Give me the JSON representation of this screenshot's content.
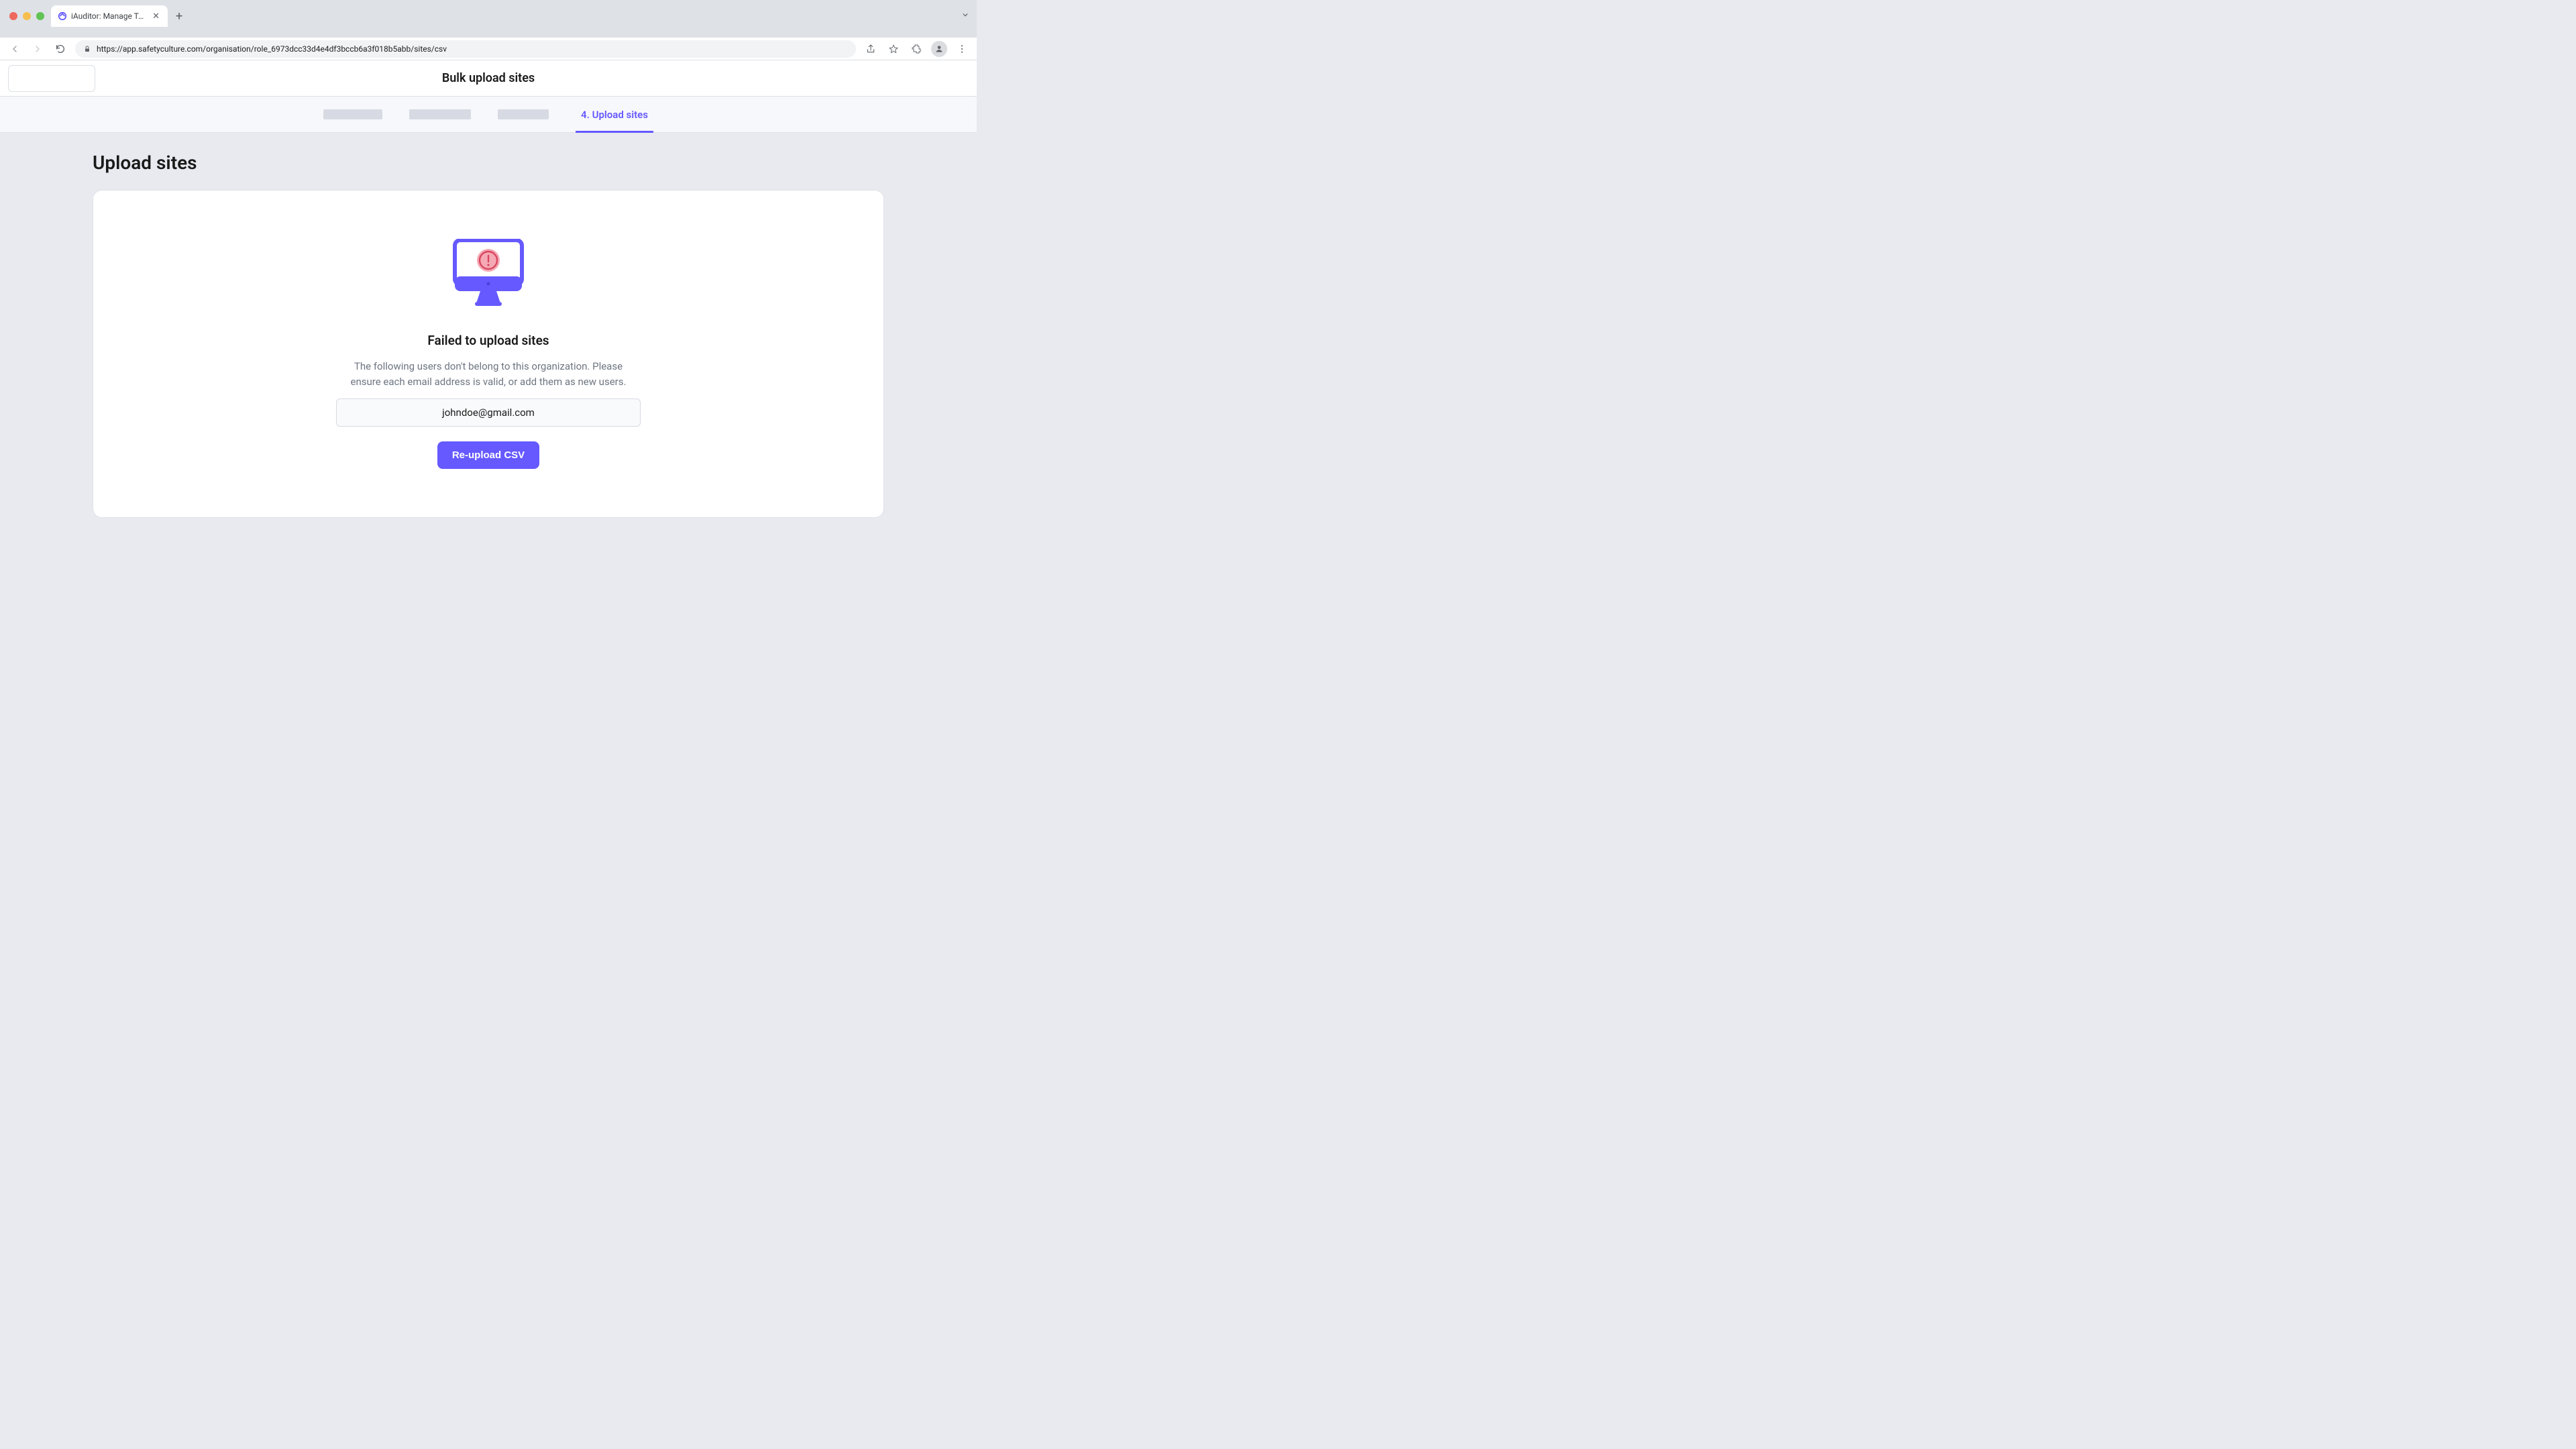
{
  "browser": {
    "tab_title": "iAuditor: Manage Teams and In",
    "url": "https://app.safetyculture.com/organisation/role_6973dcc33d4e4df3bccb6a3f018b5abb/sites/csv"
  },
  "header": {
    "title": "Bulk upload sites"
  },
  "stepper": {
    "active_label": "4. Upload sites"
  },
  "page": {
    "heading": "Upload sites"
  },
  "error_card": {
    "title": "Failed to upload sites",
    "description": "The following users don't belong to this organization. Please ensure each email address is valid, or add them as new users.",
    "email": "johndoe@gmail.com",
    "button_label": "Re-upload CSV"
  },
  "colors": {
    "accent": "#6559ff",
    "error_pink": "#f4a9b4"
  }
}
